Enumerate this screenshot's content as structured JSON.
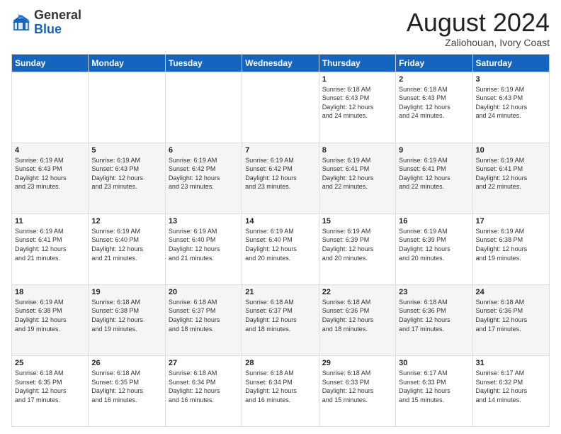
{
  "logo": {
    "general": "General",
    "blue": "Blue"
  },
  "header": {
    "month": "August 2024",
    "location": "Zaliohouan, Ivory Coast"
  },
  "days_of_week": [
    "Sunday",
    "Monday",
    "Tuesday",
    "Wednesday",
    "Thursday",
    "Friday",
    "Saturday"
  ],
  "weeks": [
    [
      {
        "day": "",
        "info": ""
      },
      {
        "day": "",
        "info": ""
      },
      {
        "day": "",
        "info": ""
      },
      {
        "day": "",
        "info": ""
      },
      {
        "day": "1",
        "info": "Sunrise: 6:18 AM\nSunset: 6:43 PM\nDaylight: 12 hours\nand 24 minutes."
      },
      {
        "day": "2",
        "info": "Sunrise: 6:18 AM\nSunset: 6:43 PM\nDaylight: 12 hours\nand 24 minutes."
      },
      {
        "day": "3",
        "info": "Sunrise: 6:19 AM\nSunset: 6:43 PM\nDaylight: 12 hours\nand 24 minutes."
      }
    ],
    [
      {
        "day": "4",
        "info": "Sunrise: 6:19 AM\nSunset: 6:43 PM\nDaylight: 12 hours\nand 23 minutes."
      },
      {
        "day": "5",
        "info": "Sunrise: 6:19 AM\nSunset: 6:43 PM\nDaylight: 12 hours\nand 23 minutes."
      },
      {
        "day": "6",
        "info": "Sunrise: 6:19 AM\nSunset: 6:42 PM\nDaylight: 12 hours\nand 23 minutes."
      },
      {
        "day": "7",
        "info": "Sunrise: 6:19 AM\nSunset: 6:42 PM\nDaylight: 12 hours\nand 23 minutes."
      },
      {
        "day": "8",
        "info": "Sunrise: 6:19 AM\nSunset: 6:41 PM\nDaylight: 12 hours\nand 22 minutes."
      },
      {
        "day": "9",
        "info": "Sunrise: 6:19 AM\nSunset: 6:41 PM\nDaylight: 12 hours\nand 22 minutes."
      },
      {
        "day": "10",
        "info": "Sunrise: 6:19 AM\nSunset: 6:41 PM\nDaylight: 12 hours\nand 22 minutes."
      }
    ],
    [
      {
        "day": "11",
        "info": "Sunrise: 6:19 AM\nSunset: 6:41 PM\nDaylight: 12 hours\nand 21 minutes."
      },
      {
        "day": "12",
        "info": "Sunrise: 6:19 AM\nSunset: 6:40 PM\nDaylight: 12 hours\nand 21 minutes."
      },
      {
        "day": "13",
        "info": "Sunrise: 6:19 AM\nSunset: 6:40 PM\nDaylight: 12 hours\nand 21 minutes."
      },
      {
        "day": "14",
        "info": "Sunrise: 6:19 AM\nSunset: 6:40 PM\nDaylight: 12 hours\nand 20 minutes."
      },
      {
        "day": "15",
        "info": "Sunrise: 6:19 AM\nSunset: 6:39 PM\nDaylight: 12 hours\nand 20 minutes."
      },
      {
        "day": "16",
        "info": "Sunrise: 6:19 AM\nSunset: 6:39 PM\nDaylight: 12 hours\nand 20 minutes."
      },
      {
        "day": "17",
        "info": "Sunrise: 6:19 AM\nSunset: 6:38 PM\nDaylight: 12 hours\nand 19 minutes."
      }
    ],
    [
      {
        "day": "18",
        "info": "Sunrise: 6:19 AM\nSunset: 6:38 PM\nDaylight: 12 hours\nand 19 minutes."
      },
      {
        "day": "19",
        "info": "Sunrise: 6:18 AM\nSunset: 6:38 PM\nDaylight: 12 hours\nand 19 minutes."
      },
      {
        "day": "20",
        "info": "Sunrise: 6:18 AM\nSunset: 6:37 PM\nDaylight: 12 hours\nand 18 minutes."
      },
      {
        "day": "21",
        "info": "Sunrise: 6:18 AM\nSunset: 6:37 PM\nDaylight: 12 hours\nand 18 minutes."
      },
      {
        "day": "22",
        "info": "Sunrise: 6:18 AM\nSunset: 6:36 PM\nDaylight: 12 hours\nand 18 minutes."
      },
      {
        "day": "23",
        "info": "Sunrise: 6:18 AM\nSunset: 6:36 PM\nDaylight: 12 hours\nand 17 minutes."
      },
      {
        "day": "24",
        "info": "Sunrise: 6:18 AM\nSunset: 6:36 PM\nDaylight: 12 hours\nand 17 minutes."
      }
    ],
    [
      {
        "day": "25",
        "info": "Sunrise: 6:18 AM\nSunset: 6:35 PM\nDaylight: 12 hours\nand 17 minutes."
      },
      {
        "day": "26",
        "info": "Sunrise: 6:18 AM\nSunset: 6:35 PM\nDaylight: 12 hours\nand 16 minutes."
      },
      {
        "day": "27",
        "info": "Sunrise: 6:18 AM\nSunset: 6:34 PM\nDaylight: 12 hours\nand 16 minutes."
      },
      {
        "day": "28",
        "info": "Sunrise: 6:18 AM\nSunset: 6:34 PM\nDaylight: 12 hours\nand 16 minutes."
      },
      {
        "day": "29",
        "info": "Sunrise: 6:18 AM\nSunset: 6:33 PM\nDaylight: 12 hours\nand 15 minutes."
      },
      {
        "day": "30",
        "info": "Sunrise: 6:17 AM\nSunset: 6:33 PM\nDaylight: 12 hours\nand 15 minutes."
      },
      {
        "day": "31",
        "info": "Sunrise: 6:17 AM\nSunset: 6:32 PM\nDaylight: 12 hours\nand 14 minutes."
      }
    ]
  ]
}
